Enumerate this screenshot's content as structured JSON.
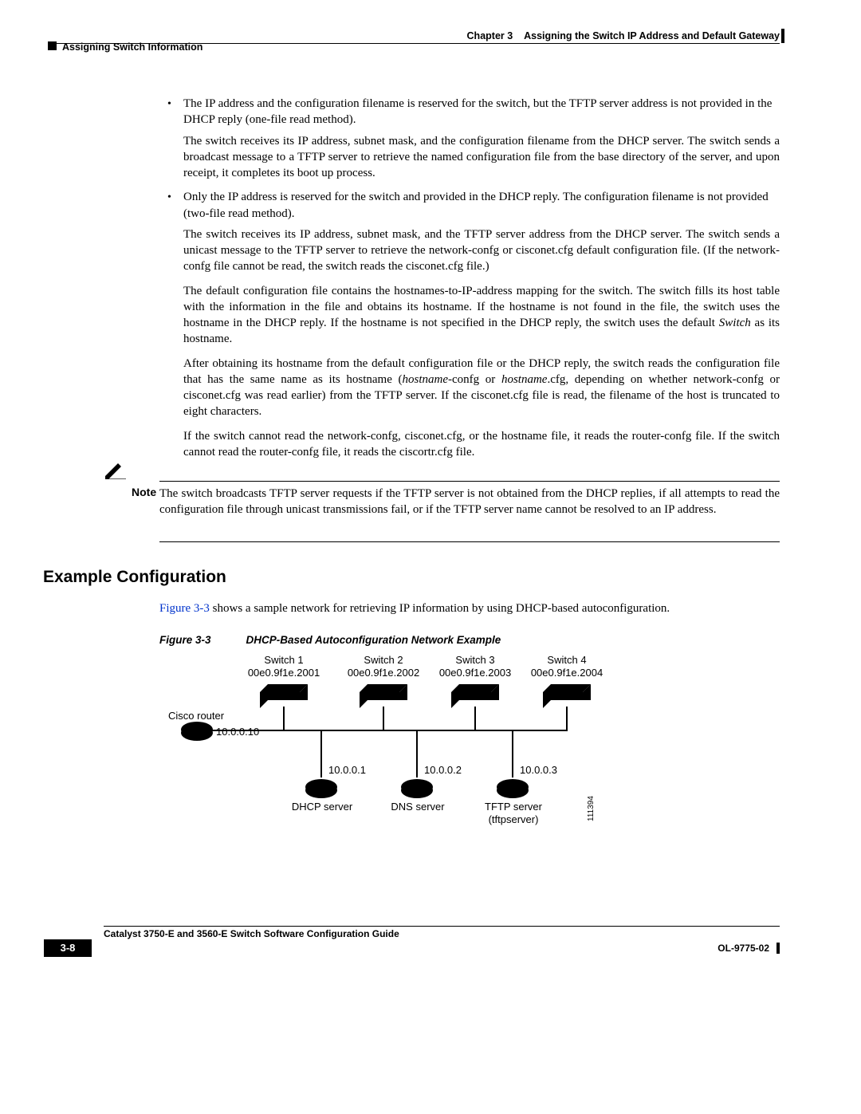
{
  "header": {
    "chapter": "Chapter 3",
    "title": "Assigning the Switch IP Address and Default Gateway",
    "section": "Assigning Switch Information"
  },
  "bullets": {
    "b1": "The IP address and the configuration filename is reserved for the switch, but the TFTP server address is not provided in the DHCP reply (one-file read method).",
    "b1p1": "The switch receives its IP address, subnet mask, and the configuration filename from the DHCP server. The switch sends a broadcast message to a TFTP server to retrieve the named configuration file from the base directory of the server, and upon receipt, it completes its boot up process.",
    "b2": "Only the IP address is reserved for the switch and provided in the DHCP reply. The configuration filename is not provided (two-file read method).",
    "b2p1": "The switch receives its IP address, subnet mask, and the TFTP server address from the DHCP server. The switch sends a unicast message to the TFTP server to retrieve the network-confg or cisconet.cfg default configuration file. (If the network-confg file cannot be read, the switch reads the cisconet.cfg file.)",
    "b2p2a": "The default configuration file contains the hostnames-to-IP-address mapping for the switch. The switch fills its host table with the information in the file and obtains its hostname. If the hostname is not found in the file, the switch uses the hostname in the DHCP reply. If the hostname is not specified in the DHCP reply, the switch uses the default ",
    "b2p2b": "Switch",
    "b2p2c": " as its hostname.",
    "b2p3a": "After obtaining its hostname from the default configuration file or the DHCP reply, the switch reads the configuration file that has the same name as its hostname (",
    "b2p3b": "hostname",
    "b2p3c": "-confg or ",
    "b2p3d": "hostname",
    "b2p3e": ".cfg, depending on whether network-confg or cisconet.cfg was read earlier) from the TFTP server. If the cisconet.cfg file is read, the filename of the host is truncated to eight characters.",
    "b2p4": "If the switch cannot read the network-confg, cisconet.cfg, or the hostname file, it reads the router-confg file. If the switch cannot read the router-confg file, it reads the ciscortr.cfg file."
  },
  "note": {
    "label": "Note",
    "text": "The switch broadcasts TFTP server requests if the TFTP server is not obtained from the DHCP replies, if all attempts to read the configuration file through unicast transmissions fail, or if the TFTP server name cannot be resolved to an IP address."
  },
  "heading": "Example Configuration",
  "intro": {
    "link": "Figure 3-3",
    "rest": " shows a sample network for retrieving IP information by using DHCP-based autoconfiguration."
  },
  "figure": {
    "num": "Figure 3-3",
    "title": "DHCP-Based Autoconfiguration Network Example",
    "switches": [
      {
        "name": "Switch 1",
        "mac": "00e0.9f1e.2001"
      },
      {
        "name": "Switch 2",
        "mac": "00e0.9f1e.2002"
      },
      {
        "name": "Switch 3",
        "mac": "00e0.9f1e.2003"
      },
      {
        "name": "Switch 4",
        "mac": "00e0.9f1e.2004"
      }
    ],
    "router": {
      "label": "Cisco router",
      "ip": "10.0.0.10"
    },
    "servers": [
      {
        "ip": "10.0.0.1",
        "label": "DHCP server",
        "sub": ""
      },
      {
        "ip": "10.0.0.2",
        "label": "DNS server",
        "sub": ""
      },
      {
        "ip": "10.0.0.3",
        "label": "TFTP server",
        "sub": "(tftpserver)"
      }
    ],
    "id": "111394"
  },
  "footer": {
    "guide": "Catalyst 3750-E and 3560-E Switch Software Configuration Guide",
    "page": "3-8",
    "docid": "OL-9775-02"
  }
}
